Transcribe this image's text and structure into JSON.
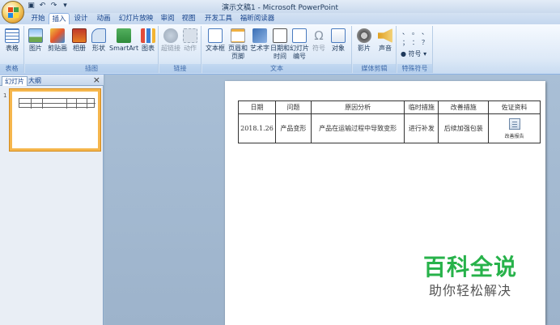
{
  "window": {
    "title": "演示文稿1 - Microsoft PowerPoint"
  },
  "quick_access": [
    "save",
    "undo",
    "redo",
    "customize"
  ],
  "tabs": [
    "开始",
    "插入",
    "设计",
    "动画",
    "幻灯片放映",
    "审阅",
    "视图",
    "开发工具",
    "福昕阅读器"
  ],
  "active_tab": "插入",
  "ribbon": {
    "groups": [
      {
        "label": "表格",
        "buttons": [
          "表格"
        ]
      },
      {
        "label": "插图",
        "buttons": [
          "图片",
          "剪贴画",
          "相册",
          "形状",
          "SmartArt",
          "图表"
        ]
      },
      {
        "label": "链接",
        "buttons": [
          "超链接",
          "动作"
        ]
      },
      {
        "label": "文本",
        "buttons": [
          "文本框",
          "页眉和页脚",
          "艺术字",
          "日期和时间",
          "幻灯片编号",
          "符号",
          "对象"
        ]
      },
      {
        "label": "媒体剪辑",
        "buttons": [
          "影片",
          "声音"
        ]
      },
      {
        "label": "特殊符号",
        "buttons": [
          "符号"
        ]
      }
    ],
    "symbol_glyphs": [
      "、",
      "。",
      "、",
      "；",
      "：",
      "？"
    ]
  },
  "left_pane": {
    "tabs": [
      "幻灯片",
      "大纲"
    ],
    "active_tab": "幻灯片",
    "close_label": "×",
    "slide_number": "1"
  },
  "slide_table": {
    "headers": [
      "日期",
      "问题",
      "原因分析",
      "临时措施",
      "改善措施",
      "佐证资料"
    ],
    "rows": [
      [
        "2018.1.26",
        "产品变形",
        "产品在运输过程中导致变形",
        "进行补发",
        "后续加强包装",
        ""
      ]
    ],
    "attachment_caption": "改善报告"
  },
  "watermark": {
    "title": "百科全说",
    "subtitle": "助你轻松解决"
  },
  "colors": {
    "accent": "#f5b64c",
    "watermark_green": "#27b24a",
    "ribbon_blue": "#c9dcf1"
  }
}
